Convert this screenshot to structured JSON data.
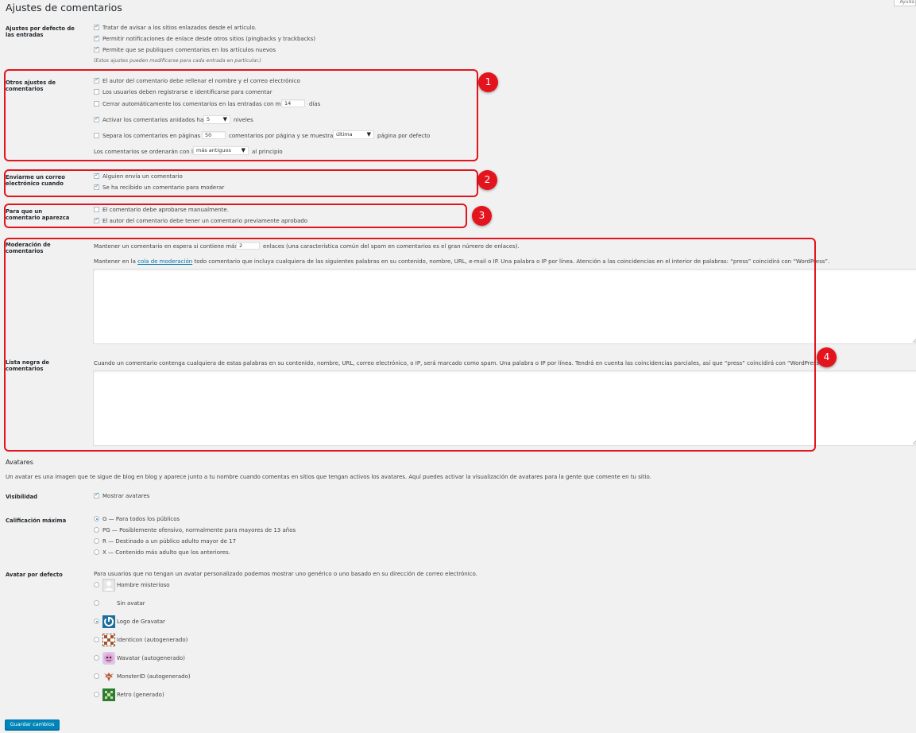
{
  "page": {
    "title": "Ajustes de comentarios",
    "help_tab": "Ayuda"
  },
  "sections": {
    "defaults": {
      "label": "Ajustes por defecto de las entradas",
      "options": [
        {
          "label": "Tratar de avisar a los sitios enlazados desde el artículo.",
          "checked": true
        },
        {
          "label": "Permitir notificaciones de enlace desde otros sitios (pingbacks y trackbacks)",
          "checked": true
        },
        {
          "label": "Permite que se publiquen comentarios en los artículos nuevos",
          "checked": true
        }
      ],
      "note": "(Estos ajustes pueden modificarse para cada entrada en particular.)"
    },
    "other": {
      "label": "Otros ajustes de comentarios",
      "opt1": "El autor del comentario debe rellenar el nombre y el correo electrónico",
      "opt2": "Los usuarios deben registrarse e identificarse para comentar",
      "opt3_pre": "Cerrar automáticamente los comentarios en las entradas con más de",
      "opt3_value": "14",
      "opt3_post": "días",
      "opt4_pre": "Activar los comentarios anidados hasta",
      "opt4_value": "5",
      "opt4_post": "niveles",
      "opt5_pre": "Separa los comentarios en páginas de",
      "opt5_value": "50",
      "opt5_mid": "comentarios por página y se muestra la",
      "opt5_select": "última",
      "opt5_post": "página por defecto",
      "order_pre": "Los comentarios se ordenarán con los",
      "order_select": "más antiguos",
      "order_post": "al principio"
    },
    "email": {
      "label": "Enviarme un correo electrónico cuando",
      "opt1": "Alguien envía un comentario",
      "opt2": "Se ha recibido un comentario para moderar"
    },
    "appear": {
      "label": "Para que un comentario aparezca",
      "opt1": "El comentario debe aprobarse manualmente.",
      "opt2": "El autor del comentario debe tener un comentario previamente aprobado"
    },
    "moderation": {
      "label": "Moderación de comentarios",
      "line1_pre": "Mantener un comentario en espera si contiene más de",
      "line1_value": "2",
      "line1_post": "enlaces (una característica común del spam en comentarios es el gran número de enlaces).",
      "line2_pre": "Mantener en la",
      "line2_link": "cola de moderación",
      "line2_post": "todo comentario que incluya cualquiera de las siguientes palabras en su contenido, nombre, URL, e-mail o IP. Una palabra o IP por línea. Atención a las coincidencias en el interior de palabras: “press” coincidirá con “WordPress”.",
      "textarea_value": ""
    },
    "blacklist": {
      "label": "Lista negra de comentarios",
      "desc": "Cuando un comentario contenga cualquiera de estas palabras en su contenido, nombre, URL, correo electrónico, o IP, será marcado como spam. Una palabra o IP por línea. Tendrá en cuenta las coincidencias parciales, así que “press” coincidirá con “WordPress”.",
      "textarea_value": ""
    },
    "avatars": {
      "heading": "Avatares",
      "intro": "Un avatar es una imagen que te sigue de blog en blog y aparece junto a tu nombre cuando comentas en sitios que tengan activos los avatares. Aquí puedes activar la visualización de avatares para la gente que comente en tu sitio.",
      "visibility_label": "Visibilidad",
      "visibility_opt": "Mostrar avatares",
      "rating_label": "Calificación máxima",
      "ratings": [
        {
          "label": "G — Para todos los públicos",
          "checked": true
        },
        {
          "label": "PG — Posiblemente ofensivo, normalmente para mayores de 13 años",
          "checked": false
        },
        {
          "label": "R — Destinado a un público adulto mayor de 17",
          "checked": false
        },
        {
          "label": "X — Contenido más adulto que los anteriores.",
          "checked": false
        }
      ],
      "default_label": "Avatar por defecto",
      "default_desc": "Para usuarios que no tengan un avatar personalizado podemos mostrar uno genérico o uno basado en su dirección de correo electrónico.",
      "defaults": [
        {
          "label": "Hombre misterioso",
          "icon": "mystery-man-icon",
          "checked": false
        },
        {
          "label": "Sin avatar",
          "icon": "blank-icon",
          "checked": false
        },
        {
          "label": "Logo de Gravatar",
          "icon": "gravatar-logo-icon",
          "checked": true
        },
        {
          "label": "Identicon (autogenerado)",
          "icon": "identicon-icon",
          "checked": false
        },
        {
          "label": "Wavatar (autogenerado)",
          "icon": "wavatar-icon",
          "checked": false
        },
        {
          "label": "MonsterID (autogenerado)",
          "icon": "monsterid-icon",
          "checked": false
        },
        {
          "label": "Retro (generado)",
          "icon": "retro-icon",
          "checked": false
        }
      ]
    }
  },
  "save_button": "Guardar cambios",
  "annotations": [
    "1",
    "2",
    "3",
    "4"
  ],
  "colors": {
    "accent": "#0085ba",
    "annotation_red": "#e3141d",
    "background": "#f1f1f1"
  }
}
